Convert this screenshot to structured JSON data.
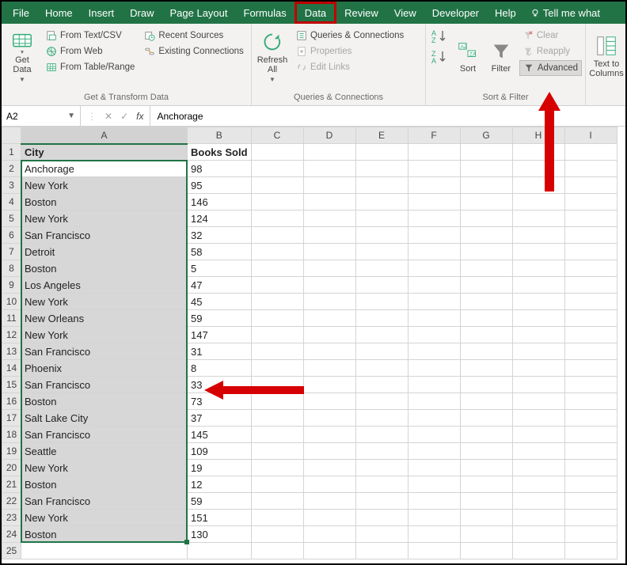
{
  "tabs": [
    "File",
    "Home",
    "Insert",
    "Draw",
    "Page Layout",
    "Formulas",
    "Data",
    "Review",
    "View",
    "Developer",
    "Help"
  ],
  "active_tab": "Data",
  "tell_me": "Tell me what",
  "ribbon": {
    "get_data": "Get\nData",
    "from_text_csv": "From Text/CSV",
    "from_web": "From Web",
    "from_table_range": "From Table/Range",
    "recent_sources": "Recent Sources",
    "existing_connections": "Existing Connections",
    "group1_label": "Get & Transform Data",
    "refresh_all": "Refresh\nAll",
    "queries_connections": "Queries & Connections",
    "properties": "Properties",
    "edit_links": "Edit Links",
    "group2_label": "Queries & Connections",
    "sort": "Sort",
    "filter": "Filter",
    "clear": "Clear",
    "reapply": "Reapply",
    "advanced": "Advanced",
    "group3_label": "Sort & Filter",
    "text_to_columns": "Text to\nColumns"
  },
  "name_box": "A2",
  "formula_value": "Anchorage",
  "columns": [
    "A",
    "B",
    "C",
    "D",
    "E",
    "F",
    "G",
    "H",
    "I"
  ],
  "header": {
    "col_a": "City",
    "col_b": "Books Sold"
  },
  "rows": [
    {
      "n": 2,
      "city": "Anchorage",
      "val": 98
    },
    {
      "n": 3,
      "city": "New York",
      "val": 95
    },
    {
      "n": 4,
      "city": "Boston",
      "val": 146
    },
    {
      "n": 5,
      "city": "New York",
      "val": 124
    },
    {
      "n": 6,
      "city": "San Francisco",
      "val": 32
    },
    {
      "n": 7,
      "city": "Detroit",
      "val": 58
    },
    {
      "n": 8,
      "city": "Boston",
      "val": 5
    },
    {
      "n": 9,
      "city": "Los Angeles",
      "val": 47
    },
    {
      "n": 10,
      "city": "New York",
      "val": 45
    },
    {
      "n": 11,
      "city": "New Orleans",
      "val": 59
    },
    {
      "n": 12,
      "city": "New York",
      "val": 147
    },
    {
      "n": 13,
      "city": "San Francisco",
      "val": 31
    },
    {
      "n": 14,
      "city": "Phoenix",
      "val": 8
    },
    {
      "n": 15,
      "city": "San Francisco",
      "val": 33
    },
    {
      "n": 16,
      "city": "Boston",
      "val": 73
    },
    {
      "n": 17,
      "city": "Salt Lake City",
      "val": 37
    },
    {
      "n": 18,
      "city": "San Francisco",
      "val": 145
    },
    {
      "n": 19,
      "city": "Seattle",
      "val": 109
    },
    {
      "n": 20,
      "city": "New York",
      "val": 19
    },
    {
      "n": 21,
      "city": "Boston",
      "val": 12
    },
    {
      "n": 22,
      "city": "San Francisco",
      "val": 59
    },
    {
      "n": 23,
      "city": "New York",
      "val": 151
    },
    {
      "n": 24,
      "city": "Boston",
      "val": 130
    }
  ],
  "empty_rows": [
    25
  ]
}
